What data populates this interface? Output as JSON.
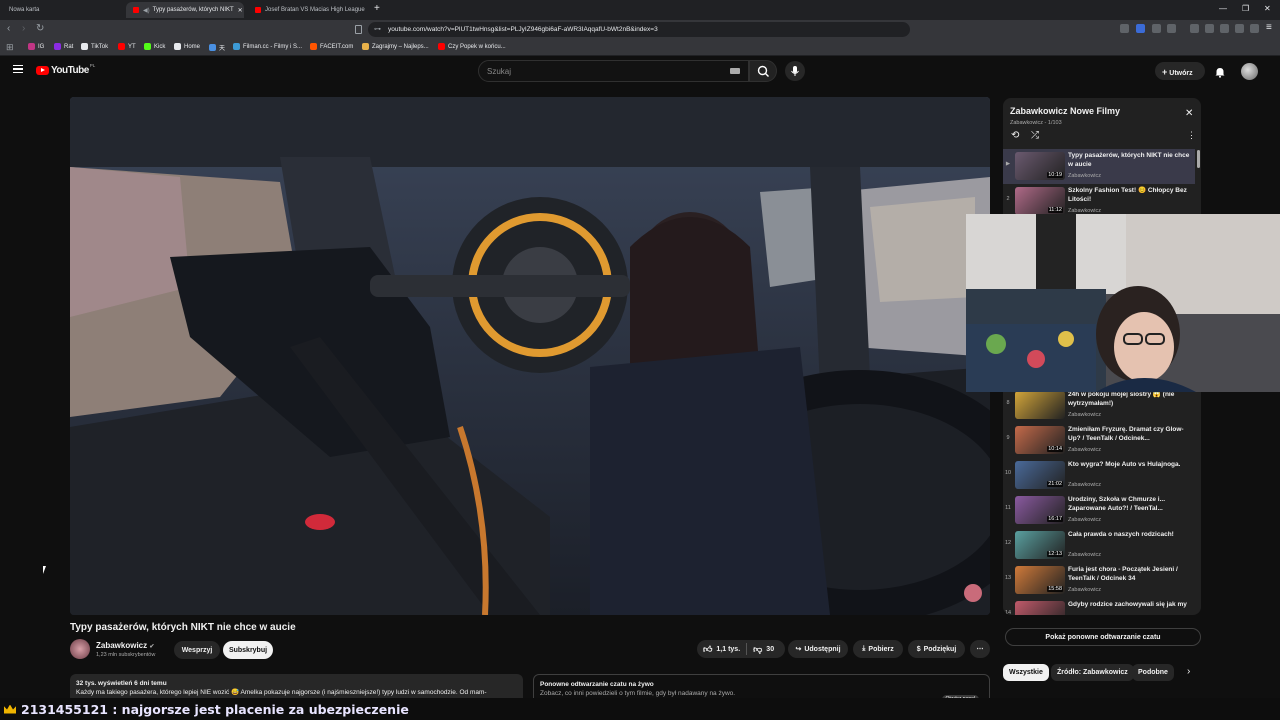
{
  "browser": {
    "tabs": [
      {
        "label": "Nowa karta"
      },
      {
        "label": "Typy pasażerów, których NIKT"
      },
      {
        "label": "Josef Bratan VS Macias High League"
      }
    ],
    "url": "youtube.com/watch?v=PlUT1twHnsg&list=PLJyIZ946gbi6aF-aWR3IAqqafU-bWt2nB&index=3",
    "bookmarks": [
      {
        "label": "IG",
        "color": "#c13584"
      },
      {
        "label": "Rat",
        "color": "#8a2be2"
      },
      {
        "label": "TikTok",
        "color": "#e8eaed"
      },
      {
        "label": "YT",
        "color": "#ff0000"
      },
      {
        "label": "Kick",
        "color": "#53fc18"
      },
      {
        "label": "Home",
        "color": "#e8eaed"
      },
      {
        "label": "天",
        "color": "#4a90e2"
      },
      {
        "label": "Filman.cc - Filmy i S...",
        "color": "#3d9bd6"
      },
      {
        "label": "FACEIT.com",
        "color": "#ff5500"
      },
      {
        "label": "Zagrajmy – Najleps...",
        "color": "#e8b14a"
      },
      {
        "label": "Czy Popek w końcu...",
        "color": "#ff0000"
      }
    ]
  },
  "youtube": {
    "logo": "YouTube",
    "region": "PL",
    "search_placeholder": "Szukaj",
    "create_label": "Utwórz"
  },
  "video": {
    "title": "Typy pasażerów, których NIKT nie chce w aucie",
    "channel": "Zabawkowicz",
    "subscribers": "1,23 mln subskrybentów",
    "support_label": "Wesprzyj",
    "subscribe_label": "Subskrybuj",
    "likes": "1,1 tys.",
    "dislikes": "30",
    "share_label": "Udostępnij",
    "download_label": "Pobierz",
    "thanks_label": "Podziękuj",
    "views_line": "32 tys. wyświetleń  6 dni temu",
    "desc_line": "Każdy ma takiego pasażera, którego lepiej NIE wozić 😅 Amelka pokazuje najgorsze (i najśmieszniejsze!) typy ludzi w samochodzie. Od mam-"
  },
  "chat_replay": {
    "title": "Ponowne odtwarzanie czatu na żywo",
    "line": "Zobacz, co inni powiedzieli o tym filmie, gdy był nadawany na żywo.",
    "button": "Otwórz panel",
    "show_button": "Pokaż ponowne odtwarzanie czatu"
  },
  "playlist": {
    "title": "Zabawkowicz Nowe Filmy",
    "subtitle": "Zabawkowicz - 1/103",
    "items": [
      {
        "num": "▶",
        "title": "Typy pasażerów, których NIKT nie chce w aucie",
        "channel": "Zabawkowicz",
        "duration": "10:19",
        "color": "#6b5a70"
      },
      {
        "num": "2",
        "title": "Szkolny Fashion Test! 😊 Chłopcy Bez Litości!",
        "channel": "Zabawkowicz",
        "duration": "11:12",
        "color": "#b06a88"
      },
      {
        "num": "8",
        "title": "24h w pokoju mojej siostry 😱 (nie wytrzymałam!)",
        "channel": "Zabawkowicz",
        "duration": "",
        "color": "#d4a63a"
      },
      {
        "num": "9",
        "title": "Zmieniłam Fryzurę. Dramat czy Glow-Up? / TeenTalk / Odcinek...",
        "channel": "Zabawkowicz",
        "duration": "10:14",
        "color": "#c46a4a"
      },
      {
        "num": "10",
        "title": "Kto wygra? Moje Auto vs Hulajnoga.",
        "channel": "Zabawkowicz",
        "duration": "21:02",
        "color": "#4a6a9a"
      },
      {
        "num": "11",
        "title": "Urodziny, Szkoła w Chmurze i... Zaparowane Auto?! / TeenTal...",
        "channel": "Zabawkowicz",
        "duration": "16:17",
        "color": "#8a5aa0"
      },
      {
        "num": "12",
        "title": "Cała prawda o naszych rodzicach!",
        "channel": "Zabawkowicz",
        "duration": "12:13",
        "color": "#5aa0a0"
      },
      {
        "num": "13",
        "title": "Furia jest chora - Początek Jesieni / TeenTalk / Odcinek 34",
        "channel": "Zabawkowicz",
        "duration": "15:58",
        "color": "#d07a3a"
      },
      {
        "num": "14",
        "title": "Gdyby rodzice zachowywali się jak my",
        "channel": "Zabawkowicz",
        "duration": "",
        "color": "#c05a6a"
      }
    ]
  },
  "chips": [
    "Wszystkie",
    "Źródło: Zabawkowicz",
    "Podobne"
  ],
  "overlay_text": "2131455121 : najgorsze jest placenie za ubezpieczenie"
}
